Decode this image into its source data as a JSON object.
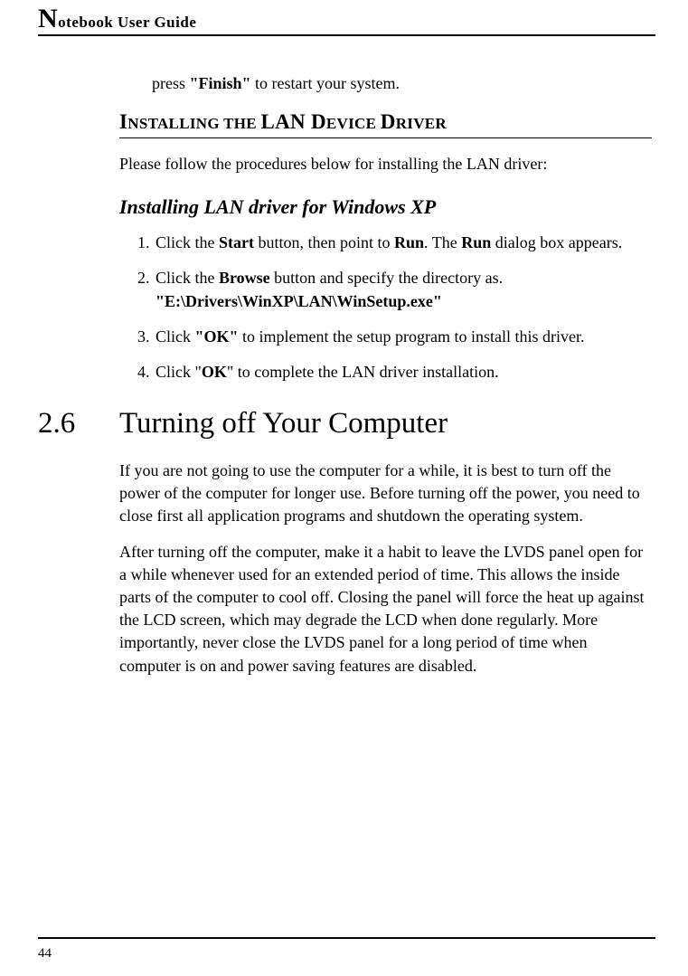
{
  "header": {
    "title_prefix": "N",
    "title_rest": "otebook User Guide"
  },
  "continuation": {
    "pre": "press ",
    "bold": "\"Finish\"",
    "post": " to restart your system."
  },
  "section_heading": {
    "l1": "I",
    "s1": "NSTALLING THE ",
    "l2": "LAN D",
    "s2": "EVICE ",
    "l3": "D",
    "s3": "RIVER"
  },
  "intro_para": "Please follow the procedures below for installing the LAN driver:",
  "sub_heading": "Installing LAN driver for Windows XP",
  "steps": [
    {
      "parts": [
        {
          "t": "Click the "
        },
        {
          "t": "Start",
          "b": true
        },
        {
          "t": " button, then point to "
        },
        {
          "t": "Run",
          "b": true
        },
        {
          "t": ". The "
        },
        {
          "t": "Run",
          "b": true
        },
        {
          "t": " dialog box appears."
        }
      ]
    },
    {
      "parts": [
        {
          "t": "Click the "
        },
        {
          "t": "Browse",
          "b": true
        },
        {
          "t": " button and specify the directory as."
        }
      ],
      "line2_bold": "\"E:\\Drivers\\WinXP\\LAN\\WinSetup.exe\""
    },
    {
      "parts": [
        {
          "t": "Click  "
        },
        {
          "t": "\"OK\"",
          "b": true
        },
        {
          "t": " to implement  the setup program to install this driver."
        }
      ]
    },
    {
      "parts": [
        {
          "t": "Click \""
        },
        {
          "t": "OK",
          "b": true
        },
        {
          "t": "\" to complete the LAN driver installation."
        }
      ]
    }
  ],
  "section26": {
    "num": "2.6",
    "title": "Turning off Your Computer"
  },
  "para1": "If you are not going to use the computer for a while, it is best to turn off the power of the computer for longer use. Before turning off the power, you need to close first all application programs and shutdown the operating system.",
  "para2": "After turning off the computer, make it a habit to leave the LVDS panel open for a while whenever used for an extended period of time. This allows the inside parts of the computer to cool off. Closing the panel will force the heat up against the LCD screen, which may degrade the LCD when done regularly. More importantly, never close the LVDS panel for a long period of time when computer is on and power saving features are disabled.",
  "page_number": "44"
}
